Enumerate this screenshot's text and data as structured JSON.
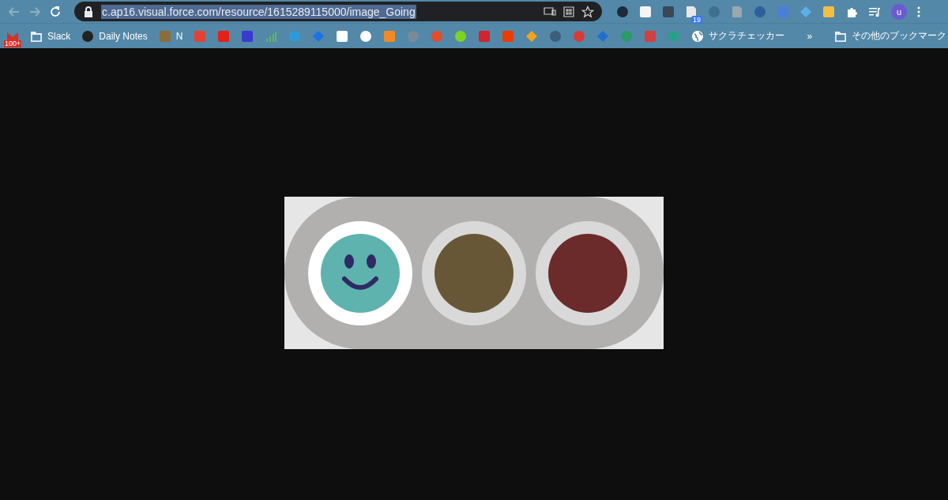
{
  "toolbar": {
    "url": "c.ap16.visual.force.com/resource/1615289115000/image_Going",
    "url_selected": true,
    "extensions": [
      {
        "kind": "circle",
        "color": "#1f2a3a"
      },
      {
        "kind": "square",
        "color": "#f4f4f4"
      },
      {
        "kind": "square",
        "color": "#3b4656"
      },
      {
        "kind": "page",
        "color": "#e8e8e8",
        "badge": "19"
      },
      {
        "kind": "circle",
        "color": "#3f6f8f"
      },
      {
        "kind": "page",
        "color": "#9aa7b0"
      },
      {
        "kind": "circle",
        "color": "#2f5f9a"
      },
      {
        "kind": "square",
        "color": "#4a7fd8"
      },
      {
        "kind": "diamond",
        "color": "#5bb0e8"
      },
      {
        "kind": "square",
        "color": "#f0c040"
      },
      {
        "kind": "puzzle",
        "color": "#ffffff"
      },
      {
        "kind": "media",
        "color": "#ffffff"
      }
    ],
    "avatar": "u"
  },
  "bookmarks": [
    {
      "kind": "app",
      "color": "#d93025",
      "label": "100+"
    },
    {
      "kind": "folder",
      "color": "#e8eef2",
      "label": "Slack"
    },
    {
      "kind": "circle",
      "color": "#222222",
      "label": "Daily Notes"
    },
    {
      "kind": "square",
      "color": "#8a6d3b",
      "label": "N"
    },
    {
      "kind": "square",
      "color": "#e34133"
    },
    {
      "kind": "square",
      "color": "#e62117"
    },
    {
      "kind": "square",
      "color": "#3a3ad0"
    },
    {
      "kind": "bars",
      "color": "#5cb85c"
    },
    {
      "kind": "circle",
      "color": "#2f9ad8"
    },
    {
      "kind": "diamond",
      "color": "#1a73e8"
    },
    {
      "kind": "square",
      "color": "#ffffff"
    },
    {
      "kind": "circle",
      "color": "#ffffff"
    },
    {
      "kind": "square",
      "color": "#f08a24"
    },
    {
      "kind": "circle",
      "color": "#7a8a96"
    },
    {
      "kind": "circle",
      "color": "#e24d2a"
    },
    {
      "kind": "circle",
      "color": "#7ed321"
    },
    {
      "kind": "square",
      "color": "#d0252d"
    },
    {
      "kind": "square",
      "color": "#eb3c00"
    },
    {
      "kind": "diamond",
      "color": "#f4a21a"
    },
    {
      "kind": "circle",
      "color": "#3a5f7a"
    },
    {
      "kind": "circle",
      "color": "#d83a3a"
    },
    {
      "kind": "diamond",
      "color": "#1f6fd0"
    },
    {
      "kind": "circle",
      "color": "#2a9a6a"
    },
    {
      "kind": "square",
      "color": "#d04040"
    },
    {
      "kind": "circle",
      "color": "#2aa08a"
    },
    {
      "kind": "globe",
      "color": "#ffffff",
      "label": "サクラチェッカー"
    }
  ],
  "more": "»",
  "other_bookmarks": "その他のブックマーク",
  "lights": [
    {
      "color": "#5fb3ae",
      "on": true
    },
    {
      "color": "#685737",
      "on": false
    },
    {
      "color": "#6b2b2a",
      "on": false
    }
  ]
}
